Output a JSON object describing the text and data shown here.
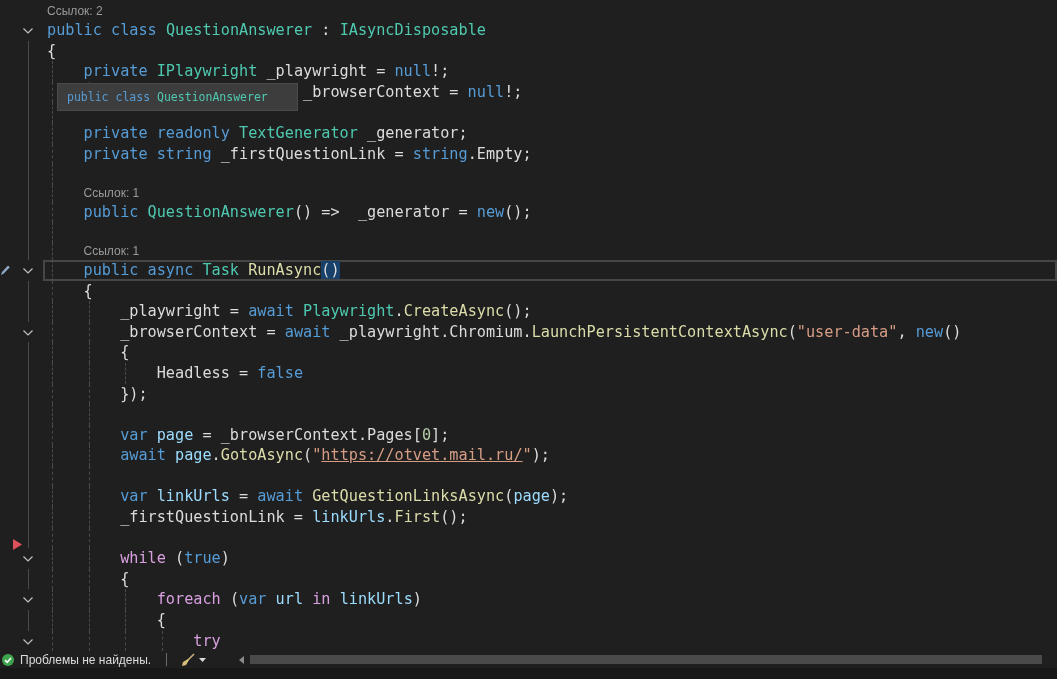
{
  "editor": {
    "lines": [
      {
        "kind": "lens",
        "text": "Ссылок: 2"
      },
      {
        "kind": "code",
        "fold": true,
        "tokens": [
          {
            "kind": "keyword",
            "text": "public class "
          },
          {
            "kind": "type",
            "text": "QuestionAnswerer"
          },
          {
            "kind": "plain",
            "text": " : "
          },
          {
            "kind": "type",
            "text": "IAsyncDisposable"
          }
        ]
      },
      {
        "kind": "code",
        "fold": false,
        "tokens": [
          {
            "kind": "plain",
            "text": "{"
          }
        ]
      },
      {
        "kind": "code",
        "fold": false,
        "tokens": [
          {
            "kind": "keyword",
            "text": "    private "
          },
          {
            "kind": "type",
            "text": "IPlaywright"
          },
          {
            "kind": "plain",
            "text": " _playwright = "
          },
          {
            "kind": "keyword",
            "text": "null"
          },
          {
            "kind": "plain",
            "text": "!;"
          }
        ]
      },
      {
        "kind": "code",
        "fold": false,
        "tokens": [
          {
            "kind": "plain",
            "text": "                            _browserContext = "
          },
          {
            "kind": "keyword",
            "text": "null"
          },
          {
            "kind": "plain",
            "text": "!;"
          }
        ]
      },
      {
        "kind": "blank"
      },
      {
        "kind": "code",
        "fold": false,
        "tokens": [
          {
            "kind": "keyword",
            "text": "    private readonly "
          },
          {
            "kind": "type",
            "text": "TextGenerator"
          },
          {
            "kind": "plain",
            "text": " _generator;"
          }
        ]
      },
      {
        "kind": "code",
        "fold": false,
        "tokens": [
          {
            "kind": "keyword",
            "text": "    private string "
          },
          {
            "kind": "plain",
            "text": "_firstQuestionLink = "
          },
          {
            "kind": "keyword",
            "text": "string"
          },
          {
            "kind": "plain",
            "text": ".Empty;"
          }
        ]
      },
      {
        "kind": "blank"
      },
      {
        "kind": "lens",
        "text": "Ссылок: 1"
      },
      {
        "kind": "code",
        "fold": false,
        "tokens": [
          {
            "kind": "keyword",
            "text": "    public "
          },
          {
            "kind": "type",
            "text": "QuestionAnswerer"
          },
          {
            "kind": "plain",
            "text": "() =>  _generator = "
          },
          {
            "kind": "keyword",
            "text": "new"
          },
          {
            "kind": "plain",
            "text": "();"
          }
        ]
      },
      {
        "kind": "blank"
      },
      {
        "kind": "lens",
        "text": "Ссылок: 1"
      },
      {
        "kind": "code",
        "fold": true,
        "current": true,
        "gutter_mark": {
          "kind": "edit"
        },
        "tokens": [
          {
            "kind": "keyword",
            "text": "    public async "
          },
          {
            "kind": "type",
            "text": "Task "
          },
          {
            "kind": "method",
            "text": "RunAsync"
          },
          {
            "kind": "brace-match",
            "text": "()"
          }
        ]
      },
      {
        "kind": "code",
        "fold": false,
        "tokens": [
          {
            "kind": "plain",
            "text": "    {"
          }
        ]
      },
      {
        "kind": "code",
        "fold": false,
        "tokens": [
          {
            "kind": "plain",
            "text": "        _playwright = "
          },
          {
            "kind": "keyword",
            "text": "await "
          },
          {
            "kind": "type",
            "text": "Playwright"
          },
          {
            "kind": "plain",
            "text": "."
          },
          {
            "kind": "method",
            "text": "CreateAsync"
          },
          {
            "kind": "plain",
            "text": "();"
          }
        ]
      },
      {
        "kind": "code",
        "fold": true,
        "tokens": [
          {
            "kind": "plain",
            "text": "        _browserContext = "
          },
          {
            "kind": "keyword",
            "text": "await "
          },
          {
            "kind": "plain",
            "text": "_playwright.Chromium."
          },
          {
            "kind": "method",
            "text": "LaunchPersistentContextAsync"
          },
          {
            "kind": "plain",
            "text": "("
          },
          {
            "kind": "string",
            "text": "\"user-data\""
          },
          {
            "kind": "plain",
            "text": ", "
          },
          {
            "kind": "keyword",
            "text": "new"
          },
          {
            "kind": "plain",
            "text": "()"
          }
        ]
      },
      {
        "kind": "code",
        "fold": false,
        "tokens": [
          {
            "kind": "plain",
            "text": "        {"
          }
        ]
      },
      {
        "kind": "code",
        "fold": false,
        "tokens": [
          {
            "kind": "plain",
            "text": "            Headless = "
          },
          {
            "kind": "keyword",
            "text": "false"
          }
        ]
      },
      {
        "kind": "code",
        "fold": false,
        "tokens": [
          {
            "kind": "plain",
            "text": "        });"
          }
        ]
      },
      {
        "kind": "blank"
      },
      {
        "kind": "code",
        "fold": false,
        "tokens": [
          {
            "kind": "keyword",
            "text": "        var "
          },
          {
            "kind": "local",
            "text": "page"
          },
          {
            "kind": "plain",
            "text": " = _browserContext.Pages["
          },
          {
            "kind": "number",
            "text": "0"
          },
          {
            "kind": "plain",
            "text": "];"
          }
        ]
      },
      {
        "kind": "code",
        "fold": false,
        "tokens": [
          {
            "kind": "keyword",
            "text": "        await "
          },
          {
            "kind": "local",
            "text": "page"
          },
          {
            "kind": "plain",
            "text": "."
          },
          {
            "kind": "method",
            "text": "GotoAsync"
          },
          {
            "kind": "plain",
            "text": "("
          },
          {
            "kind": "string",
            "text": "\""
          },
          {
            "kind": "url",
            "text": "https://otvet.mail.ru/"
          },
          {
            "kind": "string",
            "text": "\""
          },
          {
            "kind": "plain",
            "text": ");"
          }
        ]
      },
      {
        "kind": "blank"
      },
      {
        "kind": "code",
        "fold": false,
        "tokens": [
          {
            "kind": "keyword",
            "text": "        var "
          },
          {
            "kind": "local",
            "text": "linkUrls"
          },
          {
            "kind": "plain",
            "text": " = "
          },
          {
            "kind": "keyword",
            "text": "await "
          },
          {
            "kind": "method",
            "text": "GetQuestionLinksAsync"
          },
          {
            "kind": "plain",
            "text": "("
          },
          {
            "kind": "local",
            "text": "page"
          },
          {
            "kind": "plain",
            "text": ");"
          }
        ]
      },
      {
        "kind": "code",
        "fold": false,
        "tokens": [
          {
            "kind": "plain",
            "text": "        _firstQuestionLink = "
          },
          {
            "kind": "local",
            "text": "linkUrls"
          },
          {
            "kind": "plain",
            "text": "."
          },
          {
            "kind": "method",
            "text": "First"
          },
          {
            "kind": "plain",
            "text": "();"
          }
        ]
      },
      {
        "kind": "blank"
      },
      {
        "kind": "code",
        "fold": true,
        "gutter_mark": {
          "kind": "marker"
        },
        "tokens": [
          {
            "kind": "control",
            "text": "        while "
          },
          {
            "kind": "plain",
            "text": "("
          },
          {
            "kind": "keyword",
            "text": "true"
          },
          {
            "kind": "plain",
            "text": ")"
          }
        ]
      },
      {
        "kind": "code",
        "fold": false,
        "tokens": [
          {
            "kind": "plain",
            "text": "        {"
          }
        ]
      },
      {
        "kind": "code",
        "fold": true,
        "tokens": [
          {
            "kind": "control",
            "text": "            foreach "
          },
          {
            "kind": "plain",
            "text": "("
          },
          {
            "kind": "keyword",
            "text": "var "
          },
          {
            "kind": "local",
            "text": "url "
          },
          {
            "kind": "control",
            "text": "in "
          },
          {
            "kind": "local",
            "text": "linkUrls"
          },
          {
            "kind": "plain",
            "text": ")"
          }
        ]
      },
      {
        "kind": "code",
        "fold": false,
        "tokens": [
          {
            "kind": "plain",
            "text": "            {"
          }
        ]
      },
      {
        "kind": "code",
        "fold": true,
        "tokens": [
          {
            "kind": "control",
            "text": "                try"
          }
        ]
      }
    ],
    "tooltip": {
      "tokens": [
        {
          "kind": "keyword",
          "text": "public class "
        },
        {
          "kind": "type",
          "text": "QuestionAnswerer"
        }
      ]
    }
  },
  "status_bar": {
    "message": "Проблемы не найдены."
  }
}
